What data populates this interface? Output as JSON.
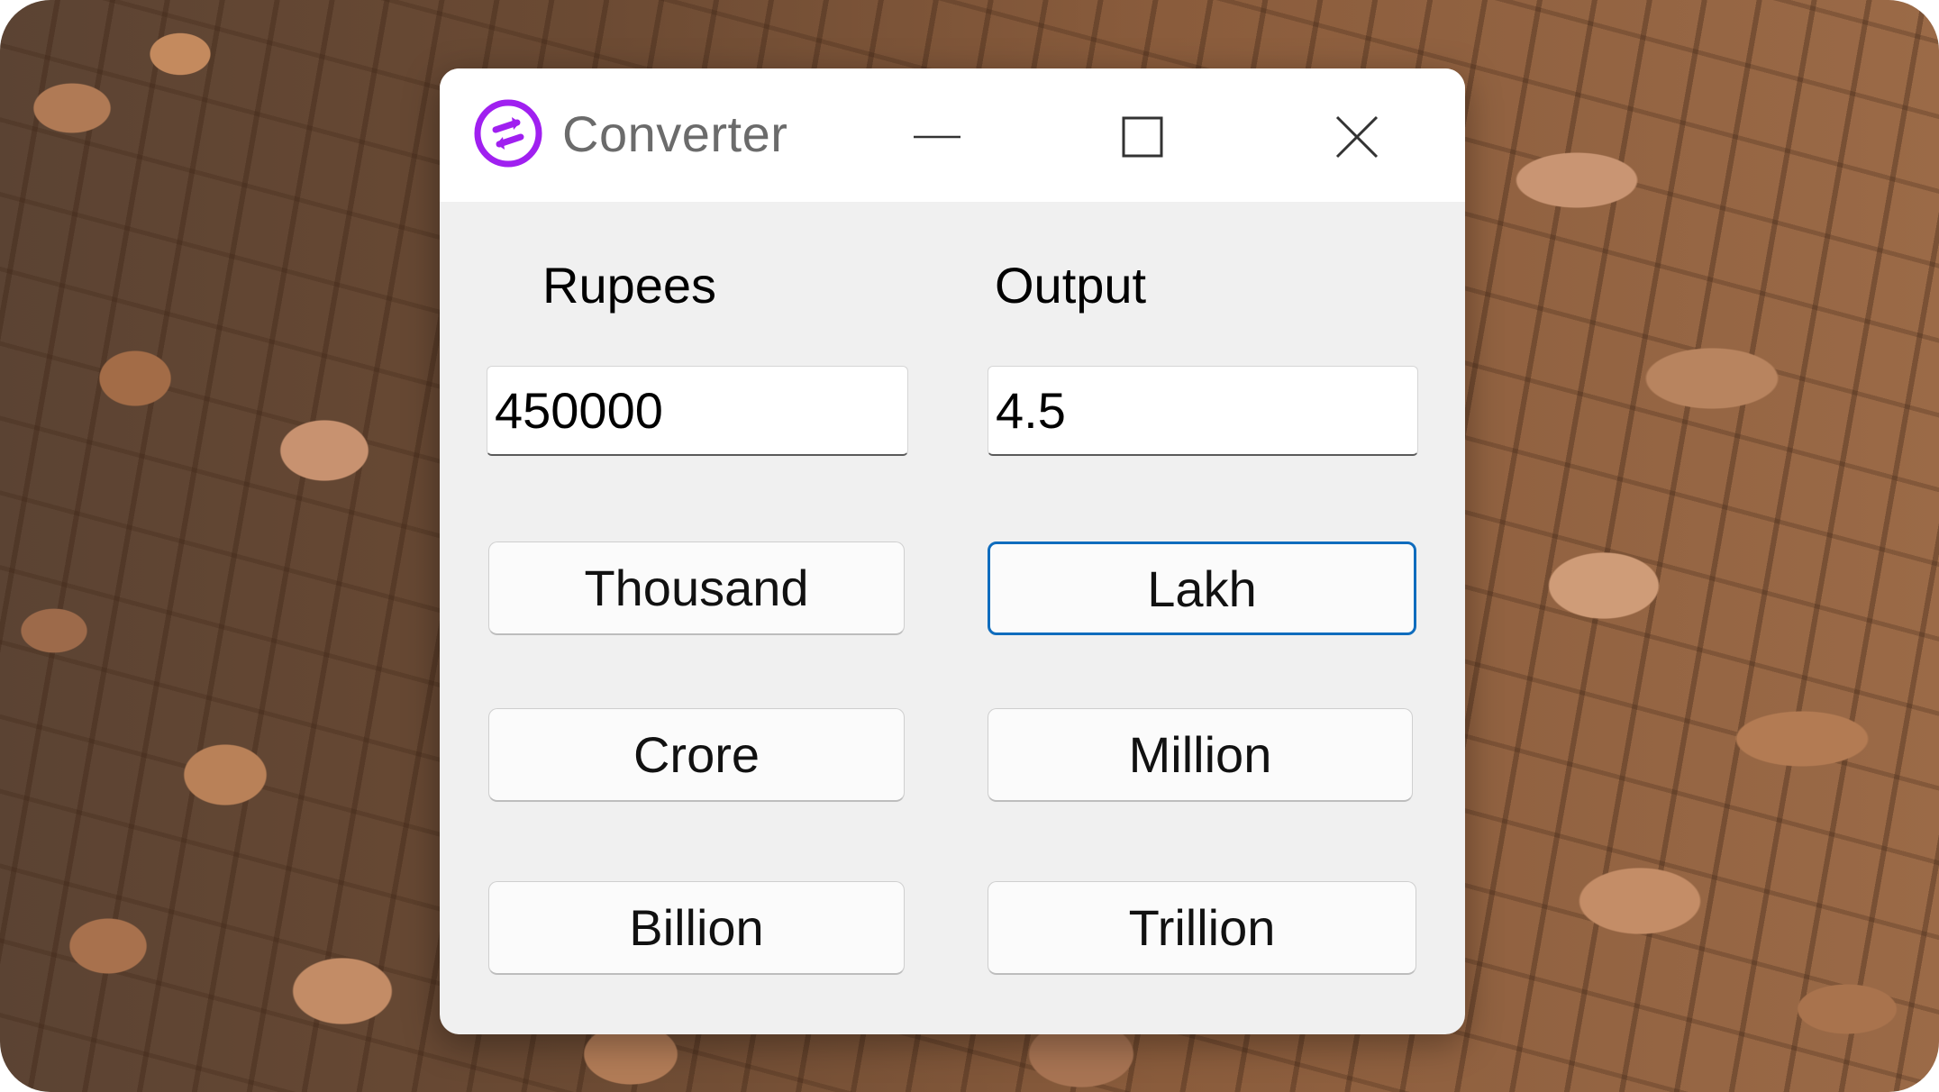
{
  "window": {
    "title": "Converter",
    "app_icon": "convert-arrows-icon",
    "controls": {
      "minimize_icon": "minimize-icon",
      "maximize_icon": "maximize-icon",
      "close_icon": "close-icon"
    }
  },
  "form": {
    "input_label": "Rupees",
    "output_label": "Output",
    "input_value": "450000",
    "output_value": "4.5"
  },
  "buttons": {
    "thousand": "Thousand",
    "lakh": "Lakh",
    "crore": "Crore",
    "million": "Million",
    "billion": "Billion",
    "trillion": "Trillion",
    "focused": "Lakh"
  },
  "colors": {
    "accent_icon": "#a020f0",
    "focus_border": "#0f6cbd",
    "window_body": "#f0f0f0",
    "title_text": "#6b6b6b"
  }
}
